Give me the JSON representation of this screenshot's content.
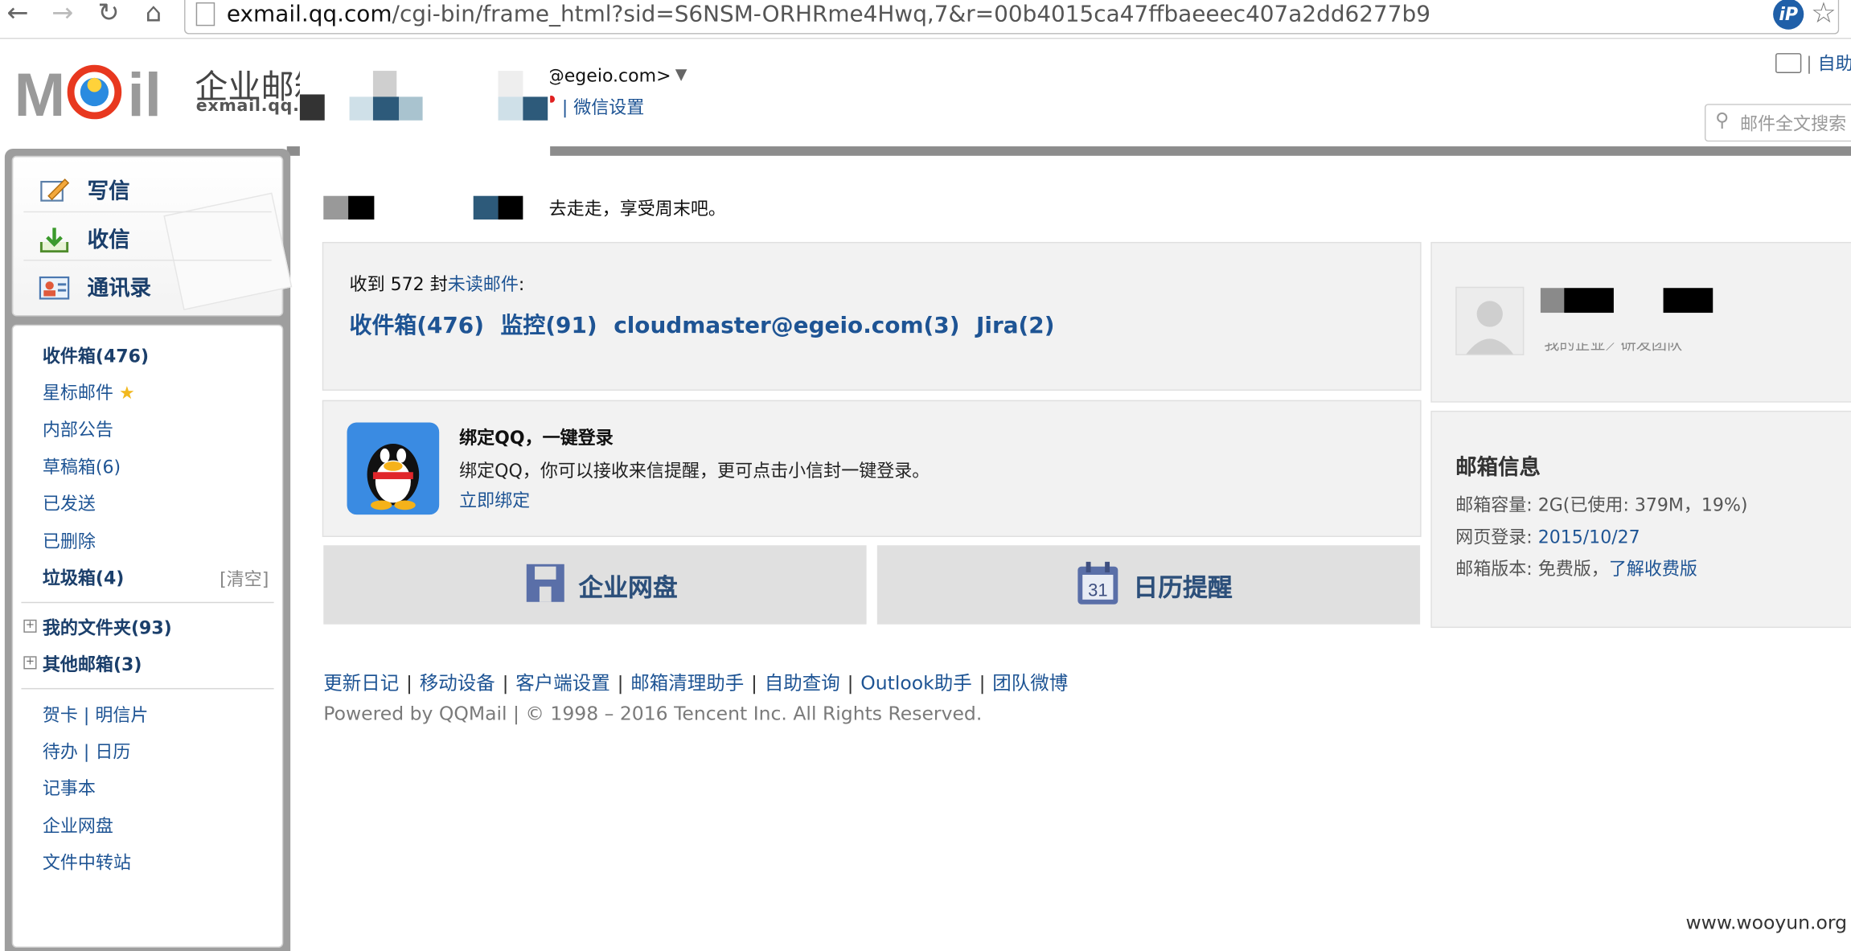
{
  "browser": {
    "url_host": "exmail.qq.com",
    "url_path": "/cgi-bin/frame_html?sid=S6NSM-ORHRme4Hwq,7&r=00b4015ca47ffbaeeec407a2dd6277b9",
    "nav_icons": [
      "back-icon",
      "forward-icon",
      "reload-icon",
      "home-icon",
      "page-icon"
    ],
    "ip_badge": "iP"
  },
  "header": {
    "logo_cn": "企业邮箱",
    "logo_en": "exmail.qq.com",
    "user_email_suffix": "@egeio.com>",
    "user_arrow": "▼",
    "wechat_settings": "| 微信设置",
    "top_right_sep": "|",
    "top_right_link": "自助",
    "search_placeholder": "邮件全文搜索"
  },
  "sidebar": {
    "quick": [
      {
        "label": "写信",
        "icon": "compose-icon"
      },
      {
        "label": "收信",
        "icon": "receive-icon"
      },
      {
        "label": "通讯录",
        "icon": "contacts-icon"
      }
    ],
    "folders": [
      {
        "label": "收件箱(476)",
        "bold": true
      },
      {
        "label": "星标邮件",
        "bold": false
      },
      {
        "label": "内部公告",
        "bold": false
      },
      {
        "label": "草稿箱(6)",
        "bold": false
      },
      {
        "label": "已发送",
        "bold": false
      },
      {
        "label": "已删除",
        "bold": false
      },
      {
        "label": "垃圾箱(4)",
        "bold": true
      }
    ],
    "clear_label": "[清空]",
    "groups": [
      {
        "label": "我的文件夹(93)"
      },
      {
        "label": "其他邮箱(3)"
      }
    ],
    "tools": [
      {
        "label": "贺卡 | 明信片"
      },
      {
        "label": "待办 | 日历"
      },
      {
        "label": "记事本"
      },
      {
        "label": "企业网盘"
      },
      {
        "label": "文件中转站"
      }
    ]
  },
  "main": {
    "greeting": "去走走，享受周末吧。",
    "unread": {
      "prefix": "收到",
      "count": "572",
      "mid": "封",
      "link": "未读邮件",
      "suffix": ":",
      "folders": [
        "收件箱(476)",
        "监控(91)",
        "cloudmaster@egeio.com(3)",
        "Jira(2)"
      ]
    },
    "qq": {
      "title": "绑定QQ，一键登录",
      "desc": "绑定QQ，你可以接收来信提醒，更可点击小信封一键登录。",
      "link": "立即绑定"
    },
    "disk_button": "企业网盘",
    "calendar_button": "日历提醒",
    "calendar_day": "31",
    "profile_sub": "我的企业／研发团队",
    "info": {
      "title": "邮箱信息",
      "capacity_label": "邮箱容量:",
      "capacity_value": "2G(已使用: 379M，19%)",
      "login_label": "网页登录:",
      "login_value": "2015/10/27",
      "version_label": "邮箱版本:",
      "version_value": "免费版，",
      "version_link": "了解收费版"
    },
    "footer_links": [
      "更新日记",
      "移动设备",
      "客户端设置",
      "邮箱清理助手",
      "自助查询",
      "Outlook助手",
      "团队微博"
    ],
    "footer_copy": "Powered by QQMail  | © 1998 – 2016 Tencent Inc. All Rights Reserved."
  },
  "watermark": "www.wooyun.org",
  "colors": {
    "link": "#1e5494",
    "frame": "#9e9e9e",
    "panel": "#f2f2f2",
    "button": "#e0e0e0"
  }
}
